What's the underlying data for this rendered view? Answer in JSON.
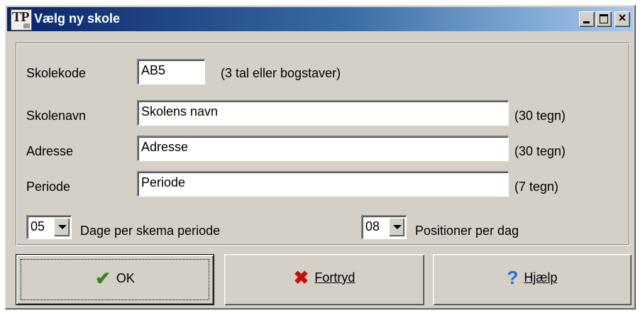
{
  "window": {
    "title": "Vælg ny skole",
    "icon": "TP",
    "controls": [
      "minimize-icon",
      "maximize-icon",
      "close-icon"
    ]
  },
  "form": {
    "skolekode": {
      "label": "Skolekode",
      "value": "AB5",
      "hint": "(3 tal eller bogstaver)"
    },
    "skolenavn": {
      "label": "Skolenavn",
      "value": "Skolens navn",
      "hint": "(30 tegn)"
    },
    "adresse": {
      "label": "Adresse",
      "value": "Adresse",
      "hint": "(30 tegn)"
    },
    "periode": {
      "label": "Periode",
      "value": "Periode",
      "hint": "(7 tegn)"
    },
    "dage": {
      "value": "05",
      "label": "Dage per skema periode"
    },
    "positioner": {
      "value": "08",
      "label": "Positioner per dag"
    }
  },
  "buttons": {
    "ok": "OK",
    "cancel": "Fortryd",
    "help": "Hjælp"
  },
  "colors": {
    "titlebar_start": "#0a246a",
    "titlebar_end": "#a6caf0",
    "ok_icon": "#2f8a17",
    "cancel_icon": "#c8100a",
    "help_icon": "#1f6fd8"
  }
}
